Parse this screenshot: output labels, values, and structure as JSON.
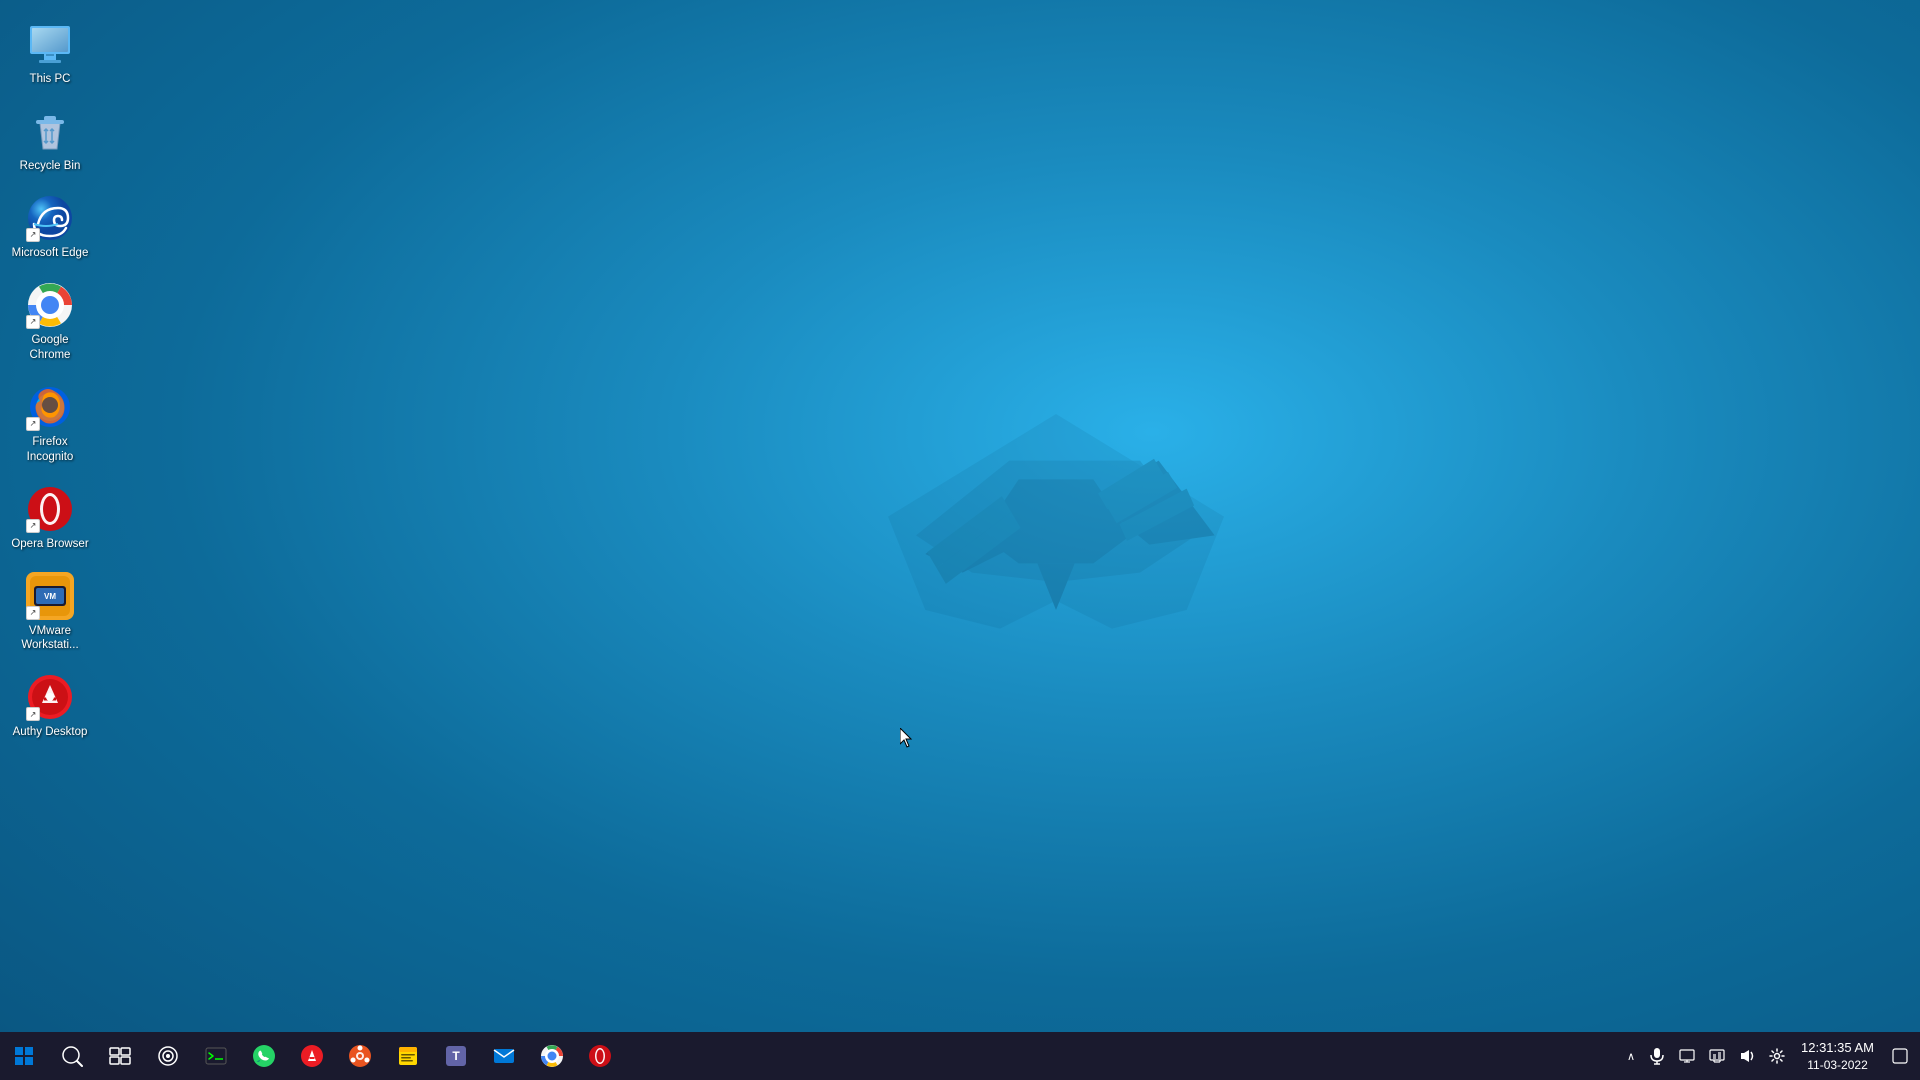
{
  "desktop": {
    "background_color": "#1a8bbf",
    "icons": [
      {
        "id": "this-pc",
        "label": "This PC",
        "type": "this-pc",
        "shortcut": false
      },
      {
        "id": "recycle-bin",
        "label": "Recycle Bin",
        "type": "recycle-bin",
        "shortcut": false
      },
      {
        "id": "microsoft-edge",
        "label": "Microsoft Edge",
        "type": "edge",
        "shortcut": true
      },
      {
        "id": "google-chrome",
        "label": "Google Chrome",
        "type": "chrome",
        "shortcut": true
      },
      {
        "id": "firefox-incognito",
        "label": "Firefox Incognito",
        "type": "firefox",
        "shortcut": true
      },
      {
        "id": "opera-browser",
        "label": "Opera Browser",
        "type": "opera",
        "shortcut": true
      },
      {
        "id": "vmware-workstation",
        "label": "VMware Workstati...",
        "type": "vmware",
        "shortcut": true
      },
      {
        "id": "authy-desktop",
        "label": "Authy Desktop",
        "type": "authy",
        "shortcut": true
      }
    ]
  },
  "taskbar": {
    "apps": [
      {
        "id": "start",
        "label": "Start",
        "type": "windows"
      },
      {
        "id": "search",
        "label": "Search",
        "type": "search-circle"
      },
      {
        "id": "task-view",
        "label": "Task View",
        "type": "task-view"
      },
      {
        "id": "cortana",
        "label": "Cortana",
        "type": "cortana"
      },
      {
        "id": "terminal",
        "label": "Terminal",
        "type": "terminal"
      },
      {
        "id": "whatsapp",
        "label": "WhatsApp",
        "type": "whatsapp"
      },
      {
        "id": "authy",
        "label": "Authy",
        "type": "authy-taskbar"
      },
      {
        "id": "ubuntu",
        "label": "Ubuntu",
        "type": "ubuntu"
      },
      {
        "id": "sticky-notes",
        "label": "Sticky Notes",
        "type": "sticky"
      },
      {
        "id": "teams",
        "label": "Microsoft Teams",
        "type": "teams"
      },
      {
        "id": "mail",
        "label": "Mail",
        "type": "mail"
      },
      {
        "id": "chrome-taskbar",
        "label": "Google Chrome",
        "type": "chrome-taskbar"
      },
      {
        "id": "opera-taskbar",
        "label": "Opera Browser",
        "type": "opera-taskbar"
      }
    ],
    "tray": {
      "show_hidden": "^",
      "microphone": "🎤",
      "remote_desktop": "💻",
      "network": "🖥",
      "sound": "🔊",
      "settings": "⚙"
    },
    "clock": {
      "time": "12:31:35 AM",
      "date": "11-03-2022"
    },
    "notification_center": "🗨"
  }
}
